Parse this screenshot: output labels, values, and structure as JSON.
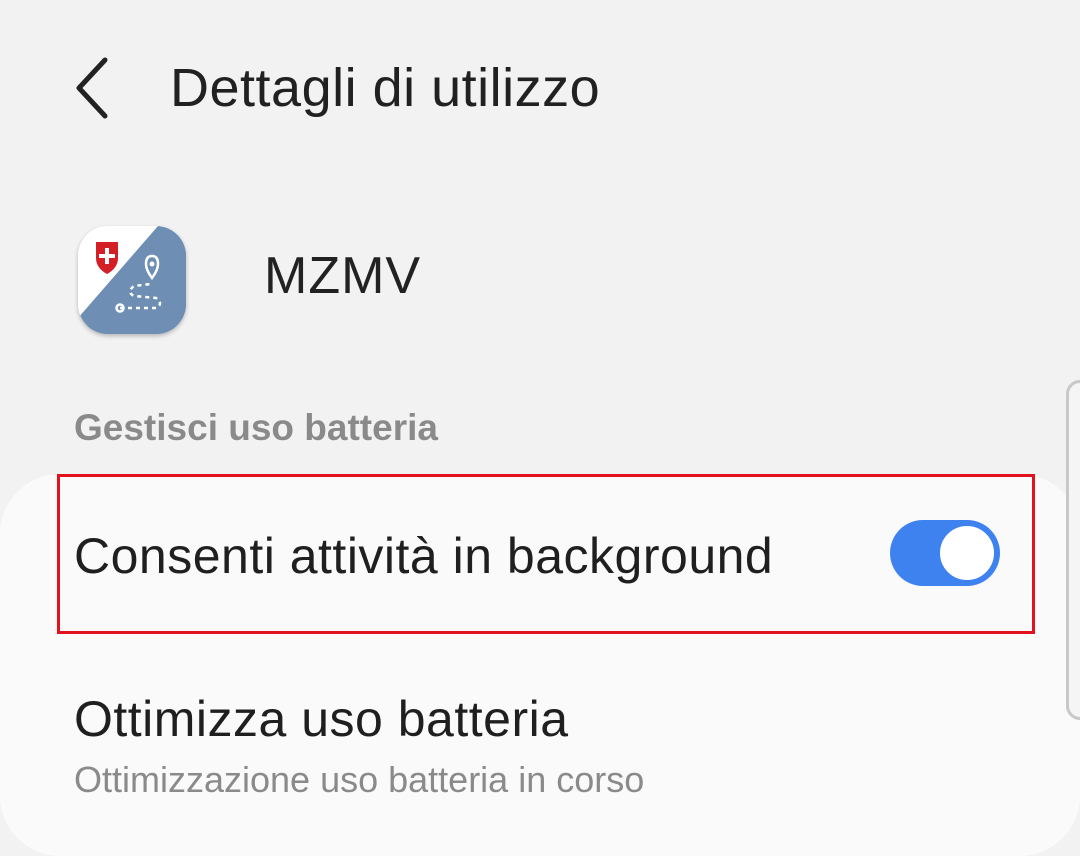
{
  "header": {
    "title": "Dettagli di utilizzo",
    "back_icon": "chevron-left-icon"
  },
  "app": {
    "name": "MZMV",
    "icon": "mzmv-app-icon"
  },
  "section": {
    "title": "Gestisci uso batteria"
  },
  "settings": {
    "background_activity": {
      "label": "Consenti attività in background",
      "enabled": true
    },
    "optimize_battery": {
      "title": "Ottimizza uso batteria",
      "subtitle": "Ottimizzazione uso batteria in corso"
    }
  },
  "colors": {
    "background": "#f2f2f2",
    "card": "#fafafa",
    "switch_on": "#3e82f0",
    "highlight": "#e3101d",
    "secondary_text": "#8a8a8a",
    "app_icon_blue": "#6e8fb3",
    "app_icon_red": "#d51f26"
  }
}
